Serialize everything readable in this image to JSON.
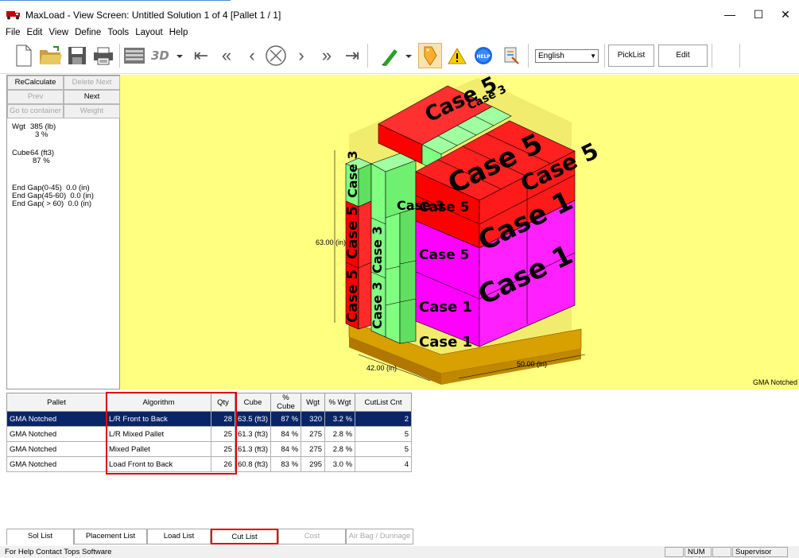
{
  "window": {
    "title": "MaxLoad - View Screen: Untitled Solution 1 of 4 [Pallet 1 / 1]",
    "minimize": "—",
    "maximize": "☐",
    "close": "✕"
  },
  "menu": [
    "File",
    "Edit",
    "View",
    "Define",
    "Tools",
    "Layout",
    "Help"
  ],
  "toolbar": {
    "language": "English",
    "picklist": "PickList",
    "edit": "Edit",
    "icons": [
      "new-file",
      "open-folder",
      "save",
      "print",
      "layout",
      "3d-view",
      "first",
      "prev-fast",
      "prev",
      "cancel",
      "next",
      "next-fast",
      "last",
      "highlighter",
      "label",
      "warning",
      "help",
      "report"
    ]
  },
  "left_panel": {
    "recalculate": "ReCalculate",
    "delete_next": "Delete Next",
    "prev": "Prev",
    "next": "Next",
    "go_to_container": "Go to container",
    "weight": "Weight",
    "wgt_label": "Wgt",
    "wgt_value": "385 (lb)",
    "wgt_pct": "3 %",
    "cube_label": "Cube",
    "cube_value": "64 (ft3)",
    "cube_pct": "87 %",
    "end_gap_1": "End Gap(0-45)  0.0 (in)",
    "end_gap_2": "End Gap(45-60)  0.0 (in)",
    "end_gap_3": "End Gap( > 60)  0.0 (in)"
  },
  "viewport": {
    "height_label": "63.00 (in)",
    "width_label": "42.00 (in)",
    "depth_label": "50.00 (in)",
    "pallet_name": "GMA Notched",
    "case_labels": [
      "Case 5",
      "Case 3",
      "Case 1"
    ],
    "colors": {
      "case5": "#ff0000",
      "case3": "#80ff80",
      "case1": "#ff00ff",
      "pallet": "#d8a000",
      "background": "#ffff80"
    }
  },
  "grid": {
    "headers": [
      "Pallet",
      "Algorithm",
      "Qty",
      "Cube",
      "% Cube",
      "Wgt",
      "% Wgt",
      "CutList Cnt"
    ],
    "rows": [
      [
        "GMA Notched",
        "L/R Front to Back",
        "28",
        "63.5 (ft3)",
        "87 %",
        "320",
        "3.2 %",
        "2"
      ],
      [
        "GMA Notched",
        "L/R Mixed Pallet",
        "25",
        "61.3 (ft3)",
        "84 %",
        "275",
        "2.8 %",
        "5"
      ],
      [
        "GMA Notched",
        "Mixed Pallet",
        "25",
        "61.3 (ft3)",
        "84 %",
        "275",
        "2.8 %",
        "5"
      ],
      [
        "GMA Notched",
        "Load Front to Back",
        "26",
        "60.8 (ft3)",
        "83 %",
        "295",
        "3.0 %",
        "4"
      ]
    ]
  },
  "tabs": [
    "Sol List",
    "Placement List",
    "Load List",
    "Cut List",
    "Cost",
    "Air Bag / Dunnage"
  ],
  "status": {
    "help": "For Help Contact Tops Software",
    "num": "NUM",
    "user": "Supervisor"
  }
}
